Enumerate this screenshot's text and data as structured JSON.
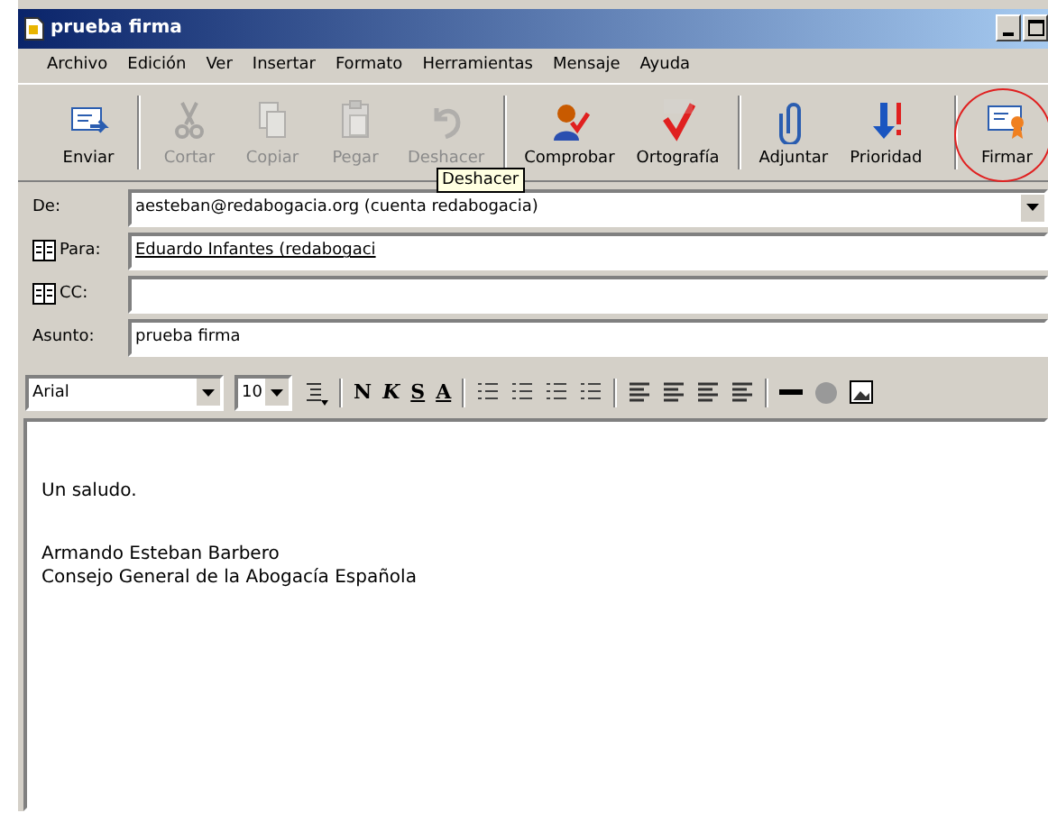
{
  "window": {
    "title": "prueba firma"
  },
  "menu": [
    "Archivo",
    "Edición",
    "Ver",
    "Insertar",
    "Formato",
    "Herramientas",
    "Mensaje",
    "Ayuda"
  ],
  "toolbar": [
    {
      "label": "Enviar",
      "disabled": false
    },
    {
      "label": "Cortar",
      "disabled": true
    },
    {
      "label": "Copiar",
      "disabled": true
    },
    {
      "label": "Pegar",
      "disabled": true
    },
    {
      "label": "Deshacer",
      "disabled": true
    },
    {
      "label": "Comprobar",
      "disabled": false
    },
    {
      "label": "Ortografía",
      "disabled": false
    },
    {
      "label": "Adjuntar",
      "disabled": false
    },
    {
      "label": "Prioridad",
      "disabled": false
    },
    {
      "label": "Firmar",
      "disabled": false,
      "highlighted": true
    }
  ],
  "tooltip": "Deshacer",
  "header": [
    {
      "label": "De:",
      "value": "aesteban@redabogacia.org    (cuenta redabogacia)",
      "kind": "dropdown"
    },
    {
      "label": "Para:",
      "value": "Eduardo Infantes (redabogaci",
      "kind": "book"
    },
    {
      "label": "CC:",
      "kind": "book"
    },
    {
      "label": "Asunto:",
      "value": "prueba firma",
      "kind": "plain"
    }
  ],
  "format": {
    "font": "Arial",
    "size": "10",
    "bold": "N",
    "italic": "K",
    "underline": "S",
    "font_color_letter": "A"
  },
  "body": {
    "greeting": "Un saludo.",
    "signature": [
      "Armando Esteban Barbero",
      "Consejo General de la Abogacía Española"
    ]
  }
}
